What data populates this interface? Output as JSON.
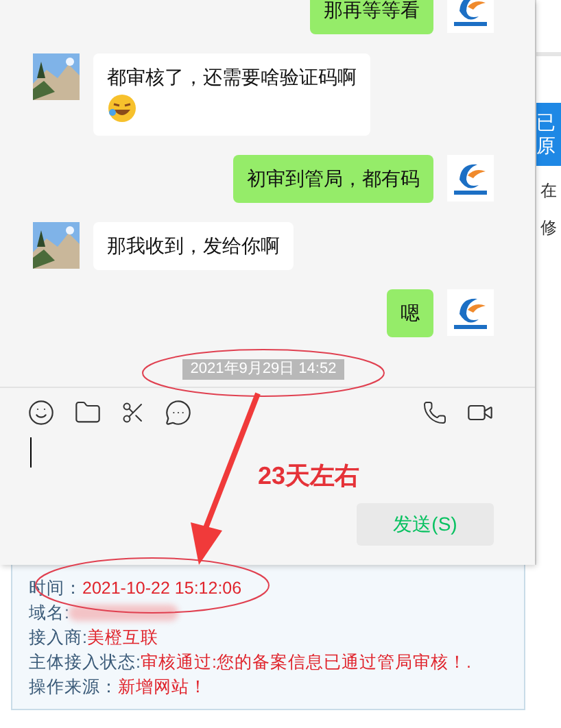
{
  "chat": {
    "messages": [
      {
        "kind": "sent",
        "text": "那再等等看",
        "emoji": false
      },
      {
        "kind": "received",
        "text": "都审核了，还需要啥验证码啊",
        "emoji": true
      },
      {
        "kind": "sent",
        "text": "初审到管局，都有码",
        "emoji": false
      },
      {
        "kind": "received",
        "text": "那我收到，发给你啊",
        "emoji": false
      },
      {
        "kind": "sent",
        "text": "嗯",
        "emoji": false
      }
    ],
    "timestamp": "2021年9月29日 14:52",
    "send_button": "发送(S)"
  },
  "background_page": {
    "banner": [
      "已",
      "原"
    ],
    "fragments": [
      "在",
      "修"
    ]
  },
  "record_panel": {
    "lines": [
      {
        "kind": "text",
        "label": "时间：",
        "value": "2021-10-22 15:12:06"
      },
      {
        "kind": "redacted",
        "label": "域名:"
      },
      {
        "kind": "text",
        "label": "接入商: ",
        "value": "美橙互联"
      },
      {
        "kind": "text",
        "label": "主体接入状态: ",
        "value": "审核通过:您的备案信息已通过管局审核！."
      },
      {
        "kind": "text",
        "label": "操作来源：",
        "value": "新增网站！"
      }
    ]
  },
  "annotation": {
    "text": "23天左右"
  }
}
